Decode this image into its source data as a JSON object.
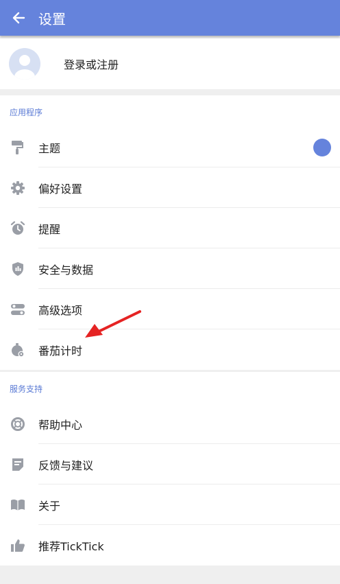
{
  "header": {
    "title": "设置"
  },
  "profile": {
    "label": "登录或注册"
  },
  "app_section": {
    "title": "应用程序",
    "items": [
      {
        "label": "主题",
        "icon": "paint-roller-icon"
      },
      {
        "label": "偏好设置",
        "icon": "gear-icon"
      },
      {
        "label": "提醒",
        "icon": "alarm-clock-icon"
      },
      {
        "label": "安全与数据",
        "icon": "shield-icon"
      },
      {
        "label": "高级选项",
        "icon": "toggles-icon"
      },
      {
        "label": "番茄计时",
        "icon": "pomodoro-timer-icon"
      }
    ],
    "theme_color": "#6583dc"
  },
  "support_section": {
    "title": "服务支持",
    "items": [
      {
        "label": "帮助中心",
        "icon": "lifebuoy-icon"
      },
      {
        "label": "反馈与建议",
        "icon": "feedback-icon"
      },
      {
        "label": "关于",
        "icon": "book-icon"
      },
      {
        "label": "推荐TickTick",
        "icon": "thumbs-up-icon"
      }
    ]
  },
  "annotation": {
    "color": "#e52323"
  }
}
